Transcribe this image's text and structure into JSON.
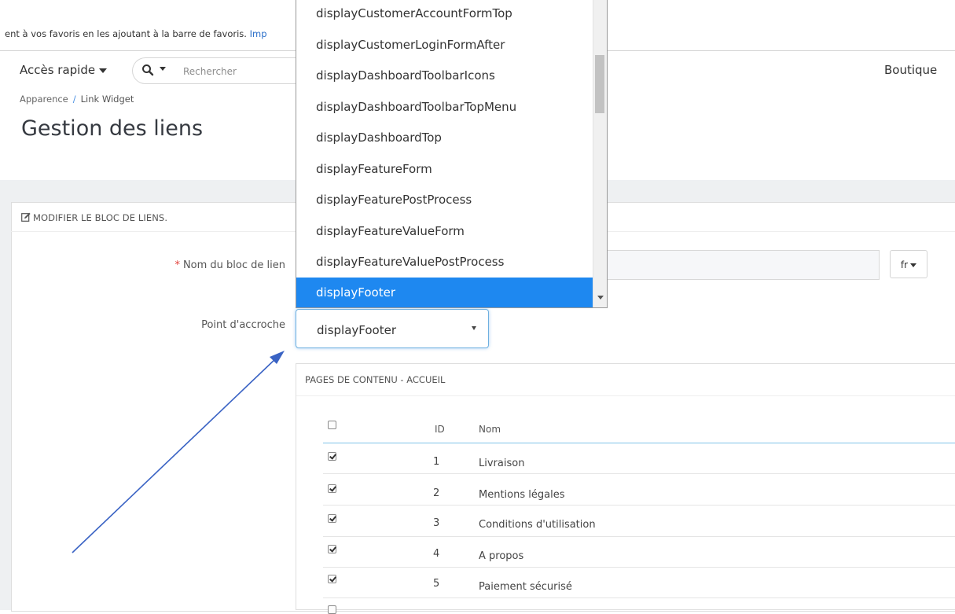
{
  "bookmarks_bar": {
    "text": "ent à vos favoris en les ajoutant à la barre de favoris.",
    "link": "Imp"
  },
  "header": {
    "quick_access": "Accès rapide",
    "search_placeholder": "Rechercher",
    "shop": "Boutique"
  },
  "breadcrumb": {
    "parent": "Apparence",
    "separator": "/",
    "current": "Link Widget"
  },
  "page_title": "Gestion des liens",
  "panel": {
    "title": "MODIFIER LE BLOC DE LIENS."
  },
  "form": {
    "name_label": "Nom du bloc de lien",
    "required_mark": "*",
    "language": "fr",
    "hook_label": "Point d'accroche",
    "hook_value": "displayFooter"
  },
  "dropdown": {
    "options": [
      "displayCustomerAccountFormTop",
      "displayCustomerLoginFormAfter",
      "displayDashboardToolbarIcons",
      "displayDashboardToolbarTopMenu",
      "displayDashboardTop",
      "displayFeatureForm",
      "displayFeaturePostProcess",
      "displayFeatureValueForm",
      "displayFeatureValuePostProcess",
      "displayFooter"
    ],
    "selected": "displayFooter"
  },
  "cms_table": {
    "title": "PAGES DE CONTENU - ACCUEIL",
    "columns": [
      "ID",
      "Nom"
    ],
    "rows": [
      {
        "id": "1",
        "name": "Livraison",
        "checked": true
      },
      {
        "id": "2",
        "name": "Mentions légales",
        "checked": true
      },
      {
        "id": "3",
        "name": "Conditions d'utilisation",
        "checked": true
      },
      {
        "id": "4",
        "name": "A propos",
        "checked": true
      },
      {
        "id": "5",
        "name": "Paiement sécurisé",
        "checked": true
      }
    ]
  },
  "colors": {
    "accent": "#1e88f0",
    "required": "#e3413b",
    "annotation_arrow": "#3a63c4"
  }
}
